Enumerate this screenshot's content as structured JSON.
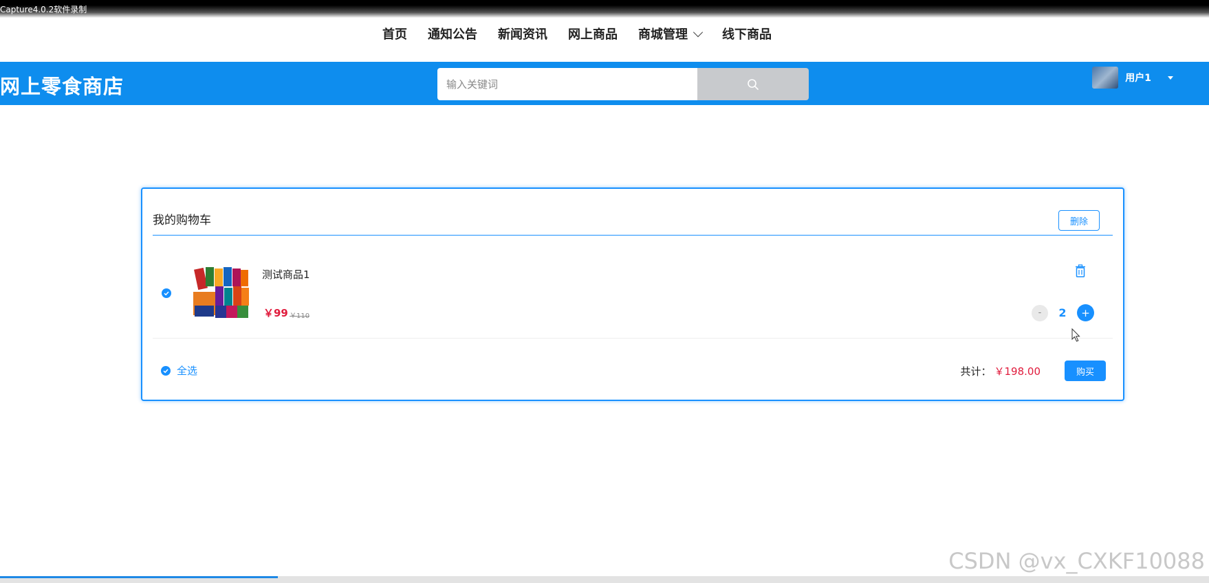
{
  "capture_label": "Capture4.0.2软件录制",
  "nav": {
    "items": [
      {
        "label": "首页"
      },
      {
        "label": "通知公告"
      },
      {
        "label": "新闻资讯"
      },
      {
        "label": "网上商品"
      },
      {
        "label": "商城管理",
        "has_dropdown": true
      },
      {
        "label": "线下商品"
      }
    ]
  },
  "header": {
    "brand": "网上零食商店",
    "search_placeholder": "输入关键词",
    "search_icon": "search-icon",
    "user_name": "用户1",
    "accent_color": "#0e8dee"
  },
  "cart": {
    "title": "我的购物车",
    "delete_label": "删除",
    "items": [
      {
        "name": "测试商品1",
        "price": "￥99",
        "original_price": "￥110",
        "quantity": "2",
        "minus_label": "-",
        "plus_label": "+",
        "checked": true
      }
    ],
    "select_all_label": "全选",
    "total_label": "共计：",
    "total_value": "￥198.00",
    "buy_label": "购买"
  },
  "watermark": "CSDN @vx_CXKF10088",
  "bottom_progress": 0.23
}
